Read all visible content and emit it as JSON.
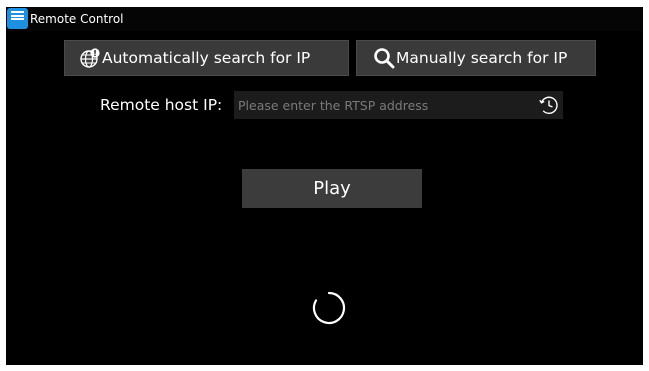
{
  "window": {
    "title": "Remote Control",
    "app_icon": "remote-control-app-icon"
  },
  "toolbar": {
    "auto_search": {
      "label": "Automatically search for IP",
      "icon": "globe-search-icon"
    },
    "manual_search": {
      "label": "Manually search for IP",
      "icon": "search-icon"
    }
  },
  "host": {
    "label": "Remote host IP:",
    "value": "",
    "placeholder": "Please enter the RTSP address",
    "history_icon": "history-icon"
  },
  "play": {
    "label": "Play"
  },
  "status": {
    "icon": "loading-spinner-icon"
  },
  "colors": {
    "background": "#000000",
    "button": "#3a3a3a",
    "input": "#1c1c1c",
    "text": "#ffffff",
    "placeholder": "#7a7a7a",
    "app_icon": "#1f8fe0"
  }
}
